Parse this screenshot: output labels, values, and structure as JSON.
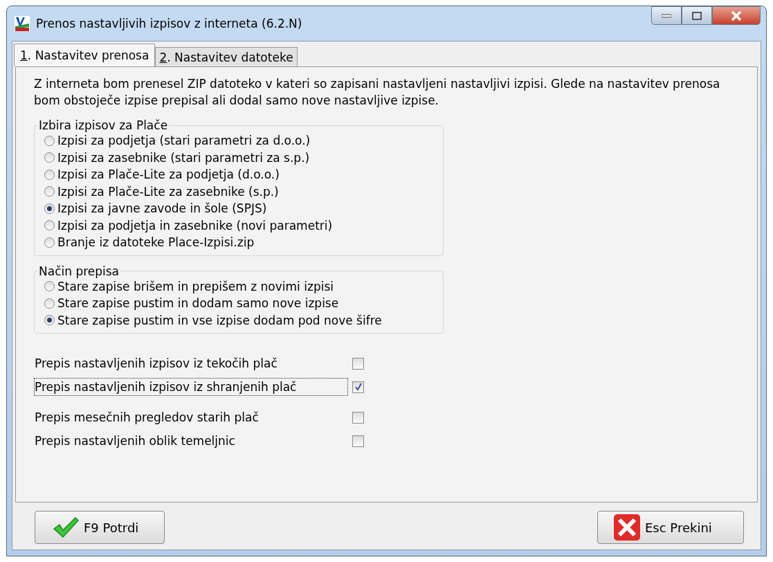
{
  "window": {
    "title": "Prenos nastavljivih izpisov z interneta  (6.2.N)"
  },
  "tabs": [
    {
      "key": "1",
      "label": ". Nastavitev prenosa",
      "selected": true
    },
    {
      "key": "2",
      "label": ". Nastavitev datoteke",
      "selected": false
    }
  ],
  "intro": "Z interneta bom prenesel ZIP datoteko v kateri so zapisani nastavljeni nastavljivi izpisi. Glede na nastavitev prenosa bom obstoječe izpise prepisal ali dodal samo nove nastavljive izpise.",
  "groups": [
    {
      "title": "Izbira izpisov za Plače",
      "options": [
        {
          "label": "Izpisi za podjetja (stari parametri za d.o.o.)",
          "selected": false
        },
        {
          "label": "Izpisi za zasebnike (stari parametri za s.p.)",
          "selected": false
        },
        {
          "label": "Izpisi za Plače-Lite za podjetja (d.o.o.)",
          "selected": false
        },
        {
          "label": "Izpisi za Plače-Lite za zasebnike (s.p.)",
          "selected": false
        },
        {
          "label": "Izpisi za javne zavode in šole (SPJS)",
          "selected": true
        },
        {
          "label": "Izpisi za podjetja in zasebnike (novi parametri)",
          "selected": false
        },
        {
          "label": "Branje iz datoteke Place-Izpisi.zip",
          "selected": false
        }
      ]
    },
    {
      "title": "Način prepisa",
      "options": [
        {
          "label": "Stare zapise brišem in prepišem z novimi izpisi",
          "selected": false
        },
        {
          "label": "Stare zapise pustim in dodam samo nove izpise",
          "selected": false
        },
        {
          "label": "Stare zapise pustim in vse izpise dodam pod nove šifre",
          "selected": true
        }
      ]
    }
  ],
  "checkboxes": [
    {
      "label": "Prepis nastavljenih izpisov iz tekočih plač",
      "checked": false,
      "focused": false
    },
    {
      "label": "Prepis nastavljenih izpisov iz shranjenih plač",
      "checked": true,
      "focused": true
    },
    {
      "label": "Prepis mesečnih pregledov starih plač",
      "checked": false,
      "focused": false
    },
    {
      "label": "Prepis nastavljenih oblik temeljnic",
      "checked": false,
      "focused": false
    }
  ],
  "buttons": [
    {
      "kind": "confirm",
      "label": "F9 Potrdi"
    },
    {
      "kind": "cancel",
      "label": "Esc Prekini"
    }
  ]
}
